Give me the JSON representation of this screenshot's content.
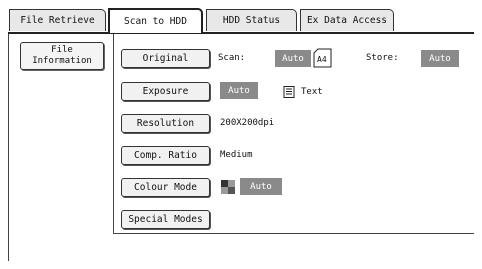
{
  "tabs": [
    {
      "label": "File Retrieve",
      "active": false
    },
    {
      "label": "Scan to HDD",
      "active": true
    },
    {
      "label": "HDD Status",
      "active": false
    },
    {
      "label": "Ex Data Access",
      "active": false
    }
  ],
  "sidebar": {
    "file_info_line1": "File",
    "file_info_line2": "Information"
  },
  "rows": {
    "original": {
      "label": "Original",
      "scan_label": "Scan:",
      "scan_value": "Auto",
      "paper_size": "A4",
      "store_label": "Store:",
      "store_value": "Auto"
    },
    "exposure": {
      "label": "Exposure",
      "value": "Auto",
      "mode": "Text"
    },
    "resolution": {
      "label": "Resolution",
      "value": "200X200dpi"
    },
    "comp_ratio": {
      "label": "Comp. Ratio",
      "value": "Medium"
    },
    "colour_mode": {
      "label": "Colour Mode",
      "value": "Auto"
    },
    "special_modes": {
      "label": "Special Modes"
    }
  },
  "colors": {
    "selected_value_bg": "#8a8a8a",
    "active_tab_bg": "#ffffff",
    "inactive_tab_bg": "#e8e8e8"
  }
}
